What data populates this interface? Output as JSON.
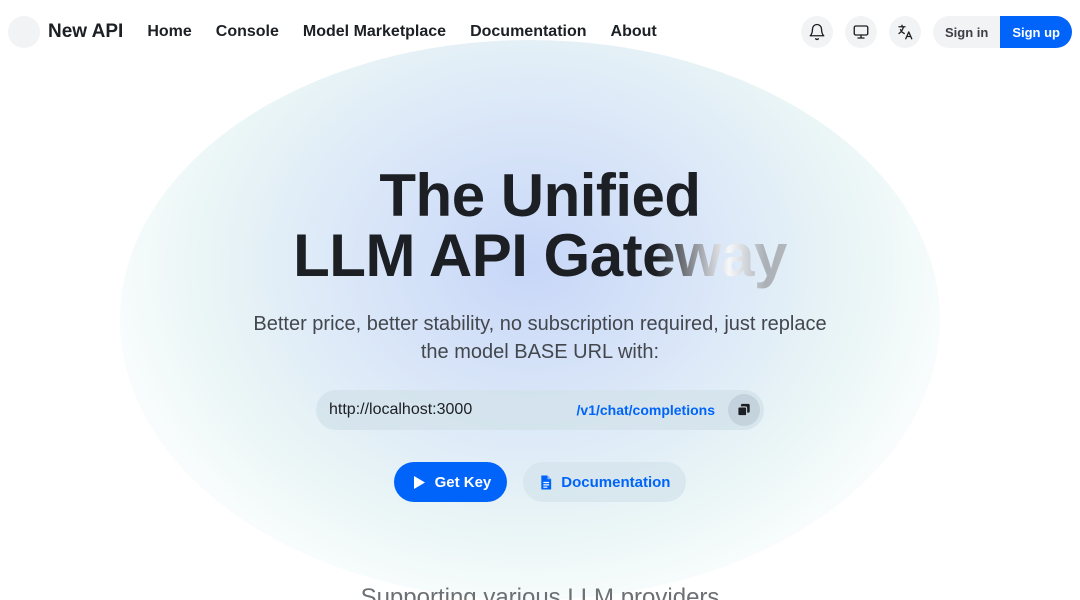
{
  "header": {
    "brand": "New API",
    "nav": [
      "Home",
      "Console",
      "Model Marketplace",
      "Documentation",
      "About"
    ],
    "icons": [
      "bell-icon",
      "monitor-icon",
      "translate-icon"
    ],
    "signin_label": "Sign in",
    "signup_label": "Sign up"
  },
  "hero": {
    "title_line1": "The Unified",
    "title_line2_a": "LLM API Gat",
    "title_line2_b": "eway",
    "subtitle": "Better price, better stability, no subscription required, just replace the model BASE URL with:",
    "url_value": "http://localhost:3000",
    "url_endpoint": "/v1/chat/completions",
    "get_key_label": "Get Key",
    "docs_label": "Documentation"
  },
  "footer_heading": "Supporting various LLM providers",
  "colors": {
    "accent": "#0064fa",
    "text": "#1c1f23"
  }
}
